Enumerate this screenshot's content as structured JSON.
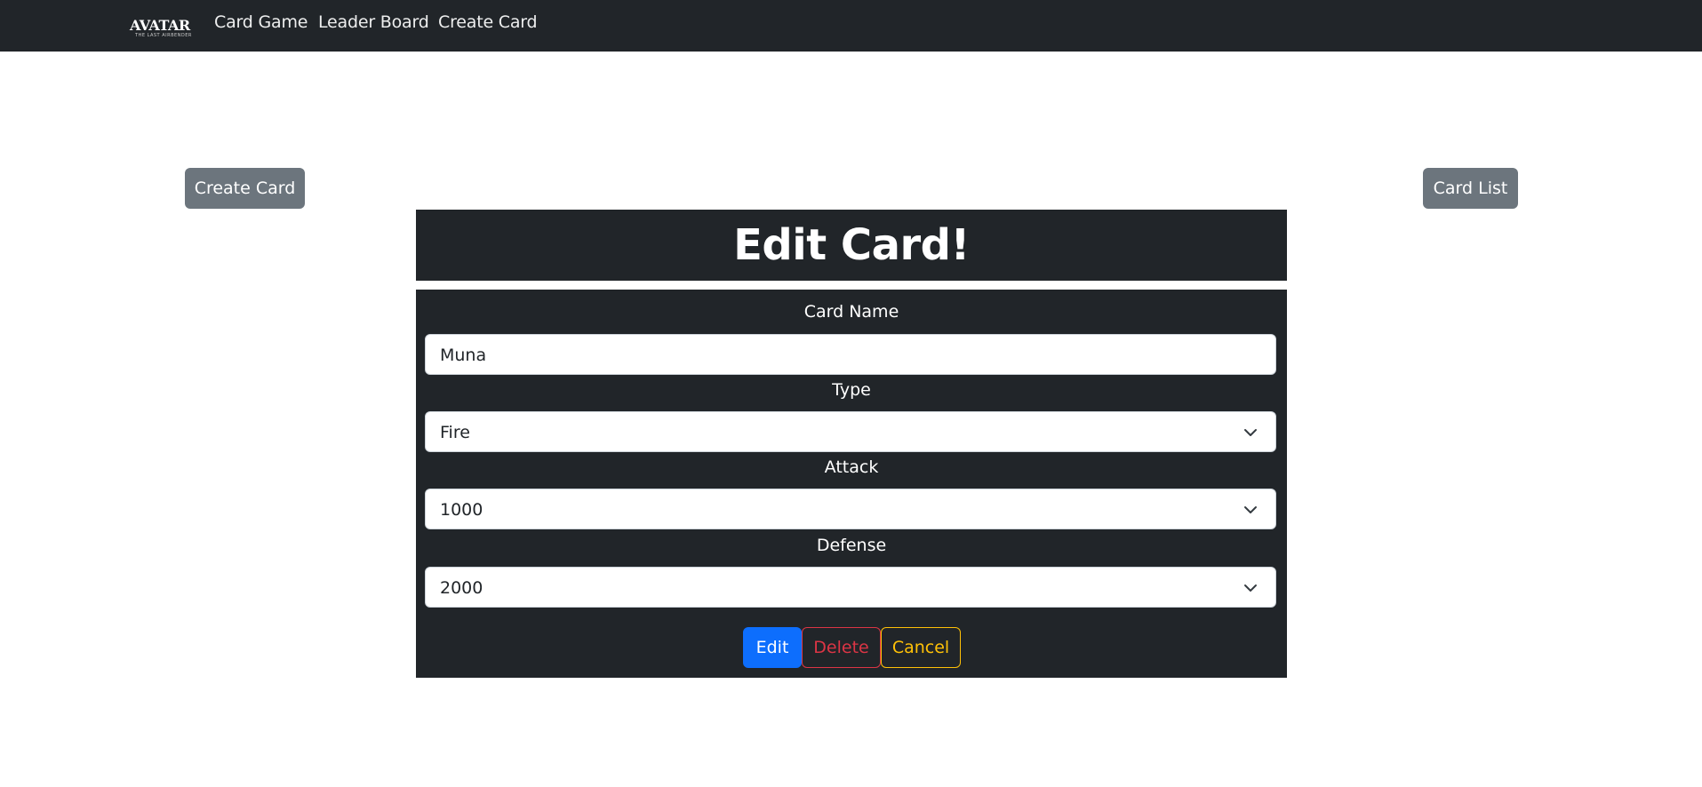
{
  "nav": {
    "logo": {
      "word": "AVATAR",
      "sub": "THE LAST AIRBENDER"
    },
    "links": [
      "Card Game",
      "Leader Board",
      "Create Card"
    ]
  },
  "actions": {
    "create_card": "Create Card",
    "card_list": "Card List"
  },
  "page_title": "Edit Card!",
  "form": {
    "card_name_label": "Card Name",
    "card_name_value": "Muna",
    "type_label": "Type",
    "type_value": "Fire",
    "attack_label": "Attack",
    "attack_value": "1000",
    "defense_label": "Defense",
    "defense_value": "2000",
    "buttons": {
      "edit": "Edit",
      "delete": "Delete",
      "cancel": "Cancel"
    }
  },
  "colors": {
    "navbar": "#212529",
    "primary": "#0d6efd",
    "danger": "#dc3545",
    "warning": "#ffc107",
    "secondary": "#6c757d"
  }
}
